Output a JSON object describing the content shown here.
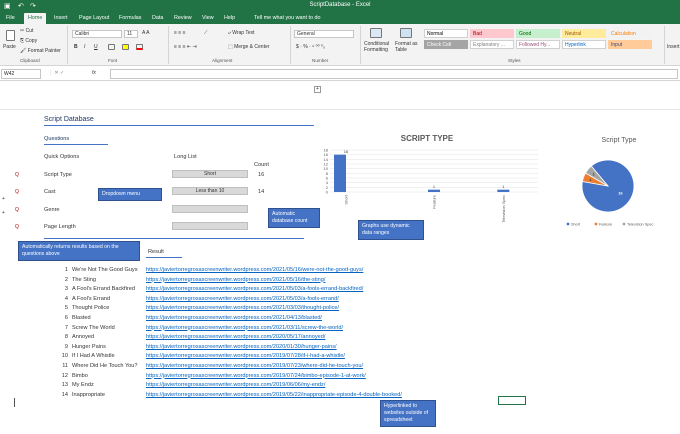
{
  "window": {
    "title": "ScriptDatabase  -  Excel"
  },
  "tabs": [
    {
      "label": "File"
    },
    {
      "label": "Home"
    },
    {
      "label": "Insert"
    },
    {
      "label": "Page Layout"
    },
    {
      "label": "Formulas"
    },
    {
      "label": "Data"
    },
    {
      "label": "Review"
    },
    {
      "label": "View"
    },
    {
      "label": "Help"
    },
    {
      "label": "Tell me what you want to do"
    }
  ],
  "ribbon": {
    "paste": "Paste",
    "cut": "Cut",
    "copy": "Copy",
    "format_painter": "Format Painter",
    "clipboard": "Clipboard",
    "font_name": "Calibri",
    "font_size": "11",
    "bold": "B",
    "italic": "I",
    "underline": "U",
    "font_group": "Font",
    "wrap_text": "Wrap Text",
    "merge_center": "Merge & Center",
    "alignment_group": "Alignment",
    "number_format": "General",
    "number_group": "Number",
    "conditional_formatting": "Conditional Formatting",
    "format_as_table": "Format as Table",
    "styles_group": "Styles",
    "cells_group": "Insert",
    "styles": [
      {
        "label": "Normal",
        "bg": "#ffffff",
        "fg": "#000000"
      },
      {
        "label": "Bad",
        "bg": "#ffc7ce",
        "fg": "#9c0006"
      },
      {
        "label": "Good",
        "bg": "#c6efce",
        "fg": "#006100"
      },
      {
        "label": "Neutral",
        "bg": "#ffeb9c",
        "fg": "#9c5700"
      },
      {
        "label": "Calculation",
        "bg": "#f2f2f2",
        "fg": "#fa7d00"
      },
      {
        "label": "Check Cell",
        "bg": "#a5a5a5",
        "fg": "#ffffff"
      },
      {
        "label": "Explanatory ...",
        "bg": "#ffffff",
        "fg": "#7f7f7f"
      },
      {
        "label": "Followed Hy...",
        "bg": "#ffffff",
        "fg": "#954f72"
      },
      {
        "label": "Hyperlink",
        "bg": "#ffffff",
        "fg": "#0563c1"
      },
      {
        "label": "Input",
        "bg": "#ffcc99",
        "fg": "#3f3f76"
      }
    ]
  },
  "formula_bar": {
    "name_box": "W42",
    "fx": "fx"
  },
  "sheet": {
    "title": "Script Database",
    "questions_header": "Questions",
    "quick_options": "Quick Options",
    "long_list": "Long List",
    "count_label": "Count",
    "questions": [
      {
        "label": "Script Type",
        "value": "Short",
        "count": "16"
      },
      {
        "label": "Cast",
        "value": "Less than 10",
        "count": "14"
      },
      {
        "label": "Genre",
        "value": "",
        "count": ""
      },
      {
        "label": "Page Length",
        "value": "",
        "count": ""
      }
    ],
    "result_label": "Result",
    "results": [
      {
        "n": "1",
        "title": "We're Not The Good Guys",
        "url": "https://javiertorregrosascreenwriter.wordpress.com/2021/05/16/were-not-the-good-guys/"
      },
      {
        "n": "2",
        "title": "The Sting",
        "url": "https://javiertorregrosascreenwriter.wordpress.com/2021/05/16/the-sting/"
      },
      {
        "n": "3",
        "title": "A Fool's Errand Backfired",
        "url": "https://javiertorregrosascreenwriter.wordpress.com/2021/05/03/a-fools-errand-backfired/"
      },
      {
        "n": "4",
        "title": "A Fool's Errand",
        "url": "https://javiertorregrosascreenwriter.wordpress.com/2021/05/03/a-fools-errand/"
      },
      {
        "n": "5",
        "title": "Thought Police",
        "url": "https://javiertorregrosascreenwriter.wordpress.com/2021/03/03/thought-police/"
      },
      {
        "n": "6",
        "title": "Blasted",
        "url": "https://javiertorregrosascreenwriter.wordpress.com/2021/04/13/blasted/"
      },
      {
        "n": "7",
        "title": "Screw The World",
        "url": "https://javiertorregrosascreenwriter.wordpress.com/2021/03/11/screw-the-world/"
      },
      {
        "n": "8",
        "title": "Annoyed",
        "url": "https://javiertorregrosascreenwriter.wordpress.com/2020/05/17/annoyed/"
      },
      {
        "n": "9",
        "title": "Hunger Pains",
        "url": "https://javiertorregrosascreenwriter.wordpress.com/2020/01/30/hunger-pains/"
      },
      {
        "n": "10",
        "title": "If I Had A Whistle",
        "url": "https://javiertorregrosascreenwriter.wordpress.com/2019/07/28/if-i-had-a-whistle/"
      },
      {
        "n": "11",
        "title": "Where Did He Touch You?",
        "url": "https://javiertorregrosascreenwriter.wordpress.com/2019/07/23/where-did-he-touch-you/"
      },
      {
        "n": "12",
        "title": "Bimbo",
        "url": "https://javiertorregrosascreenwriter.wordpress.com/2019/07/24/bimbo-episode-1-at-work/"
      },
      {
        "n": "13",
        "title": "My Endz",
        "url": "https://javiertorregrosascreenwriter.wordpress.com/2019/06/06/my-endz/"
      },
      {
        "n": "14",
        "title": "Inappropriate",
        "url": "https://javiertorregrosascreenwriter.wordpress.com/2019/05/22/inappropriate-episode-4-double-booked/"
      }
    ],
    "callouts": {
      "dropdown": "Dropdown menu",
      "auto_count": "Automatic database count",
      "dynamic": "Graphs use dynamic data ranges",
      "auto_results": "Automatically returns results based on the questions above",
      "hyperlinked": "Hyperlinked to websites outside of spreadsheet"
    }
  },
  "chart_data": [
    {
      "type": "bar",
      "title": "SCRIPT TYPE",
      "categories": [
        "Short",
        "Feature",
        "Television Spec"
      ],
      "values": [
        16,
        1,
        1
      ],
      "ylim": [
        0,
        18
      ],
      "yticks": [
        "0",
        "2",
        "4",
        "6",
        "8",
        "10",
        "12",
        "14",
        "16",
        "18"
      ],
      "color": "#4472c4",
      "grid": true
    },
    {
      "type": "pie",
      "title": "Script Type",
      "categories": [
        "Short",
        "Feature",
        "Television Spec"
      ],
      "values": [
        16,
        1,
        1
      ],
      "colors": [
        "#4472c4",
        "#ed7d31",
        "#a5a5a5"
      ],
      "legend": "bottom"
    }
  ]
}
